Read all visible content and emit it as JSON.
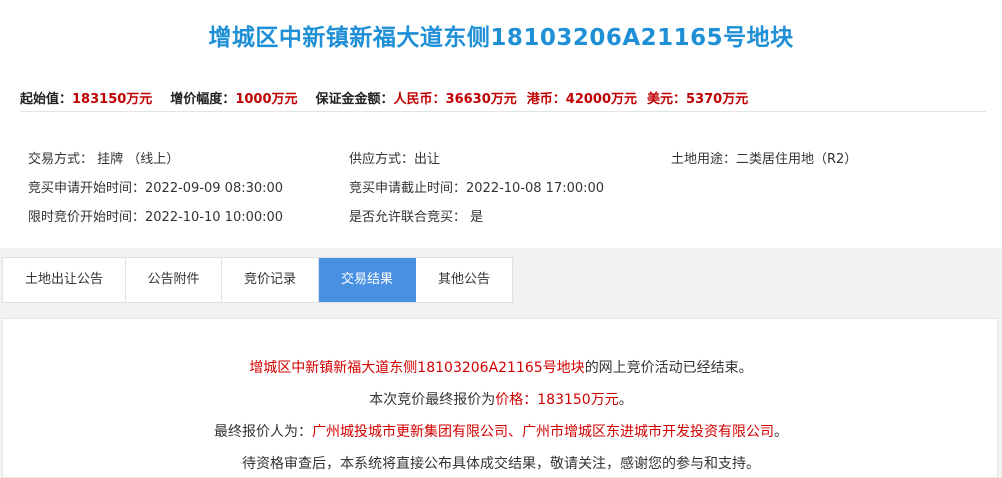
{
  "title": "增城区中新镇新福大道东侧18103206A21165号地块",
  "price": {
    "start_label": "起始值：",
    "start_value": "183150万元",
    "increment_label": "增价幅度：",
    "increment_value": "1000万元",
    "deposit_label": "保证金金额：",
    "rmb_label": "人民币：",
    "rmb_value": "36630万元",
    "hkd_label": "港币：",
    "hkd_value": "42000万元",
    "usd_label": "美元：",
    "usd_value": "5370万元"
  },
  "info": {
    "trade_mode": "交易方式： 挂牌 （线上）",
    "supply_mode": "供应方式：出让",
    "land_use": "土地用途：二类居住用地（R2）",
    "apply_start": "竞买申请开始时间：2022-09-09 08:30:00",
    "apply_end": "竞买申请截止时间：2022-10-08 17:00:00",
    "bid_start": "限时竞价开始时间：2022-10-10 10:00:00",
    "joint_bid": "是否允许联合竞买： 是"
  },
  "tabs": [
    {
      "label": "土地出让公告"
    },
    {
      "label": "公告附件"
    },
    {
      "label": "竞价记录"
    },
    {
      "label": "交易结果"
    },
    {
      "label": "其他公告"
    }
  ],
  "result": {
    "line1_name": "增城区中新镇新福大道东侧18103206A21165号地块",
    "line1_suffix": "的网上竞价活动已经结束。",
    "line2_prefix": "本次竞价最终报价为",
    "line2_value": "价格：183150万元",
    "line2_suffix": "。",
    "line3_prefix": "最终报价人为：",
    "line3_value": "广州城投城市更新集团有限公司、广州市增城区东进城市开发投资有限公司",
    "line3_suffix": "。",
    "line4": "待资格审查后，本系统将直接公布具体成交结果，敬请关注，感谢您的参与和支持。"
  },
  "colors": {
    "title": "#1f8fd6",
    "accent_red": "#d40000",
    "tab_active": "#4a90e2"
  }
}
